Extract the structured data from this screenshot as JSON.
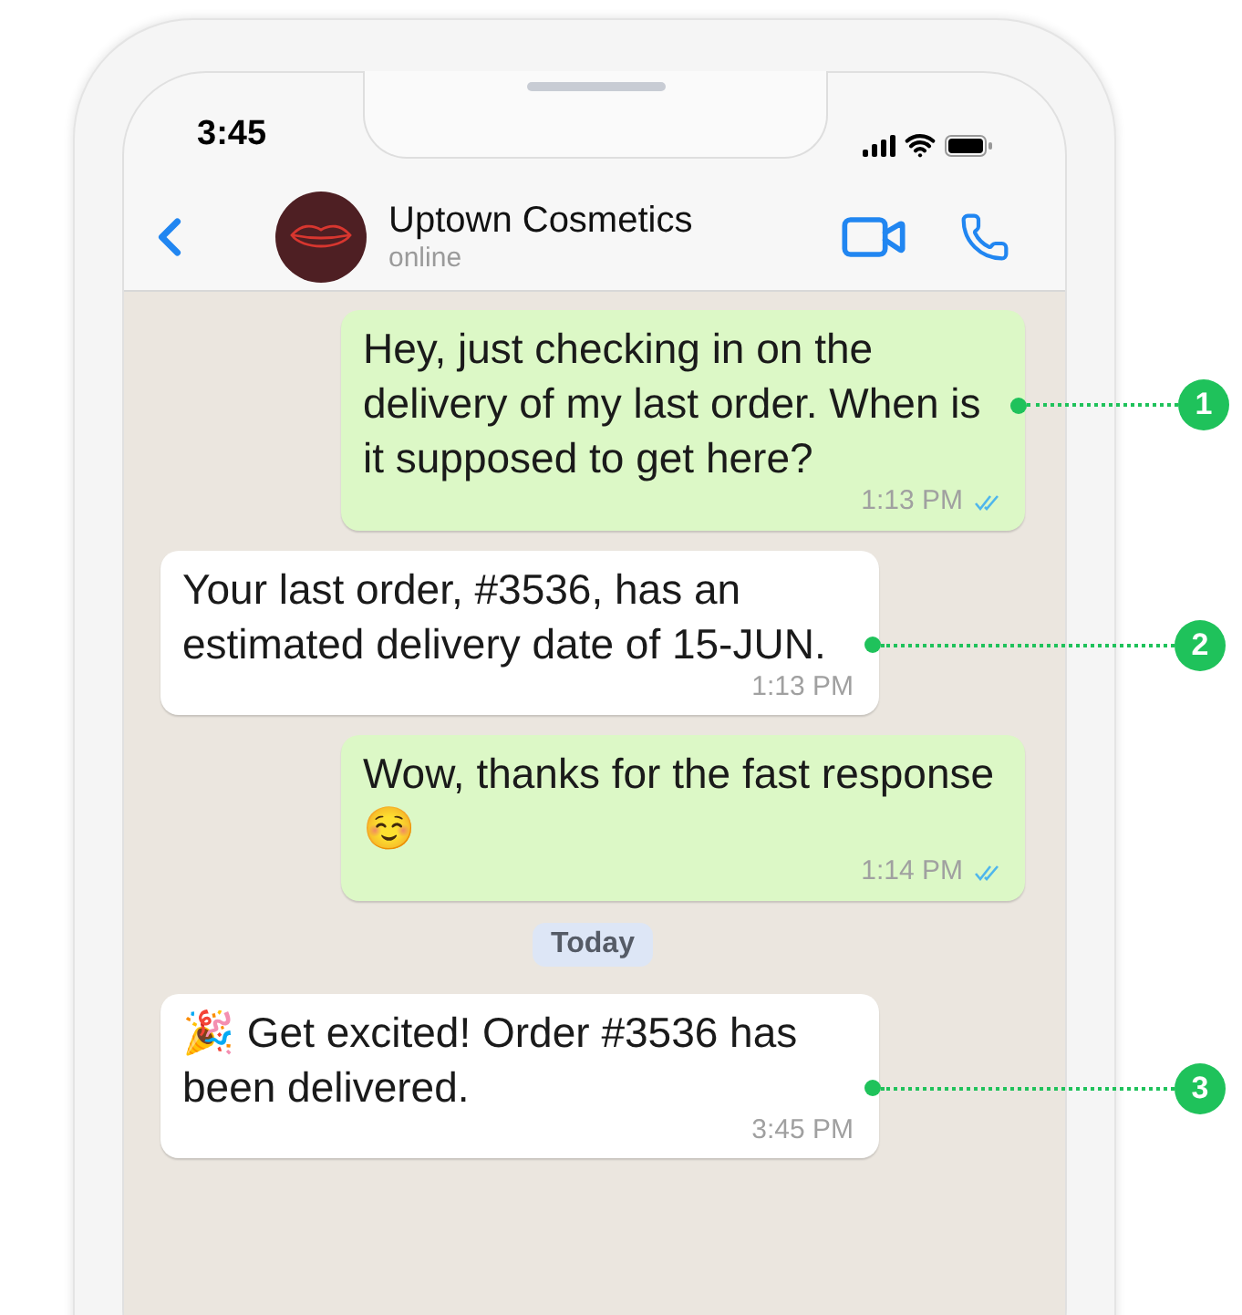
{
  "status_bar": {
    "time": "3:45"
  },
  "chat_header": {
    "name": "Uptown Cosmetics",
    "status": "online"
  },
  "messages": [
    {
      "kind": "sent",
      "text": "Hey, just checking in on the delivery of my last order. When is it supposed to get here?",
      "time": "1:13 PM",
      "read": true,
      "callout": "1"
    },
    {
      "kind": "received",
      "text": "Your last order, #3536, has an estimated delivery date of 15-JUN.",
      "time": "1:13 PM",
      "callout": "2"
    },
    {
      "kind": "sent",
      "text": "Wow, thanks for the fast response ☺️",
      "time": "1:14 PM",
      "read": true
    },
    {
      "kind": "date",
      "text": "Today"
    },
    {
      "kind": "received",
      "text": "🎉 Get excited! Order #3536 has been delivered.",
      "time": "3:45 PM",
      "callout": "3"
    }
  ]
}
